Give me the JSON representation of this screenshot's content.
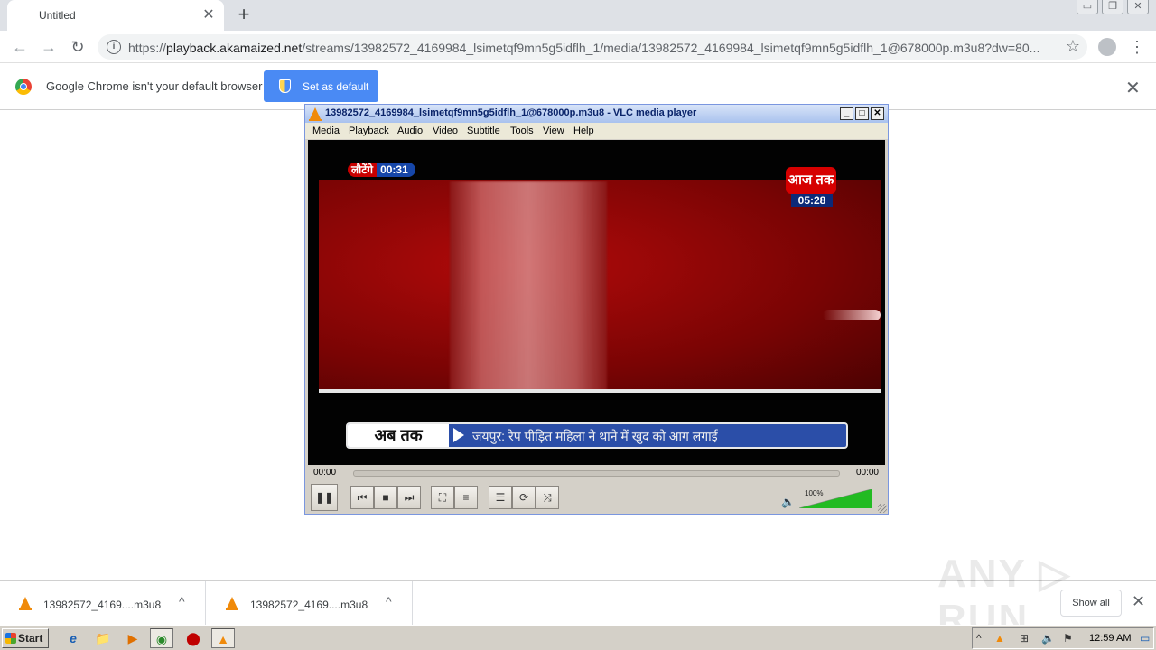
{
  "browser": {
    "tab_title": "Untitled",
    "tab_close": "✕",
    "new_tab": "+",
    "url_scheme": "https://",
    "url_host": "playback.akamaized.net",
    "url_path": "/streams/13982572_4169984_lsimetqf9mn5g5idflh_1/media/13982572_4169984_lsimetqf9mn5g5idflh_1@678000p.m3u8?dw=80...",
    "omni_icon": "i",
    "back": "←",
    "forward": "→",
    "reload": "↻",
    "star": "☆",
    "menu": "⋮",
    "window_controls": [
      "▭",
      "❐",
      "✕"
    ]
  },
  "infobar": {
    "message": "Google Chrome isn't your default browser",
    "button": "Set as default",
    "close": "✕"
  },
  "vlc": {
    "title": "13982572_4169984_lsimetqf9mn5g5idflh_1@678000p.m3u8 - VLC media player",
    "title_buttons": [
      "_",
      "□",
      "✕"
    ],
    "menu": [
      "Media",
      "Playback",
      "Audio",
      "Video",
      "Subtitle",
      "Tools",
      "View",
      "Help"
    ],
    "video": {
      "countdown_label": "लौटेंगे",
      "countdown_time": "00:31",
      "channel_logo": "आज तक",
      "channel_clock": "05:28",
      "ticker_tag": "अब तक",
      "ticker_text": "जयपुर: रेप पीड़ित महिला ने थाने में खुद को आग लगाई"
    },
    "time_elapsed": "00:00",
    "time_total": "00:00",
    "seek_progress": 0,
    "controls": {
      "pause": "❚❚",
      "prev": "⏮",
      "stop": "■",
      "next": "⏭",
      "fullscreen": "⛶",
      "extended": "≡",
      "playlist": "☰",
      "loop": "⟳",
      "shuffle": "⤨"
    },
    "volume_icon": "🔈",
    "volume_label": "100%",
    "volume_level": 1.0
  },
  "downloads": [
    {
      "name": "13982572_4169....m3u8",
      "chevron": "^"
    },
    {
      "name": "13982572_4169....m3u8",
      "chevron": "^"
    }
  ],
  "shelf": {
    "show_all": "Show all",
    "close": "✕"
  },
  "watermark": "ANY ▷ RUN",
  "taskbar": {
    "start": "Start",
    "icons": [
      "e",
      "📁",
      "▶",
      "◉",
      "⬤",
      "▲"
    ],
    "clock": "12:59 AM",
    "tray_icons": [
      "^",
      "▲",
      "⊞",
      "🔈",
      "⚑",
      "▭"
    ]
  },
  "colors": {
    "vlc_orange": "#f08a0a",
    "chrome_blue": "#4a8af4",
    "volume_green": "#22bb22"
  }
}
